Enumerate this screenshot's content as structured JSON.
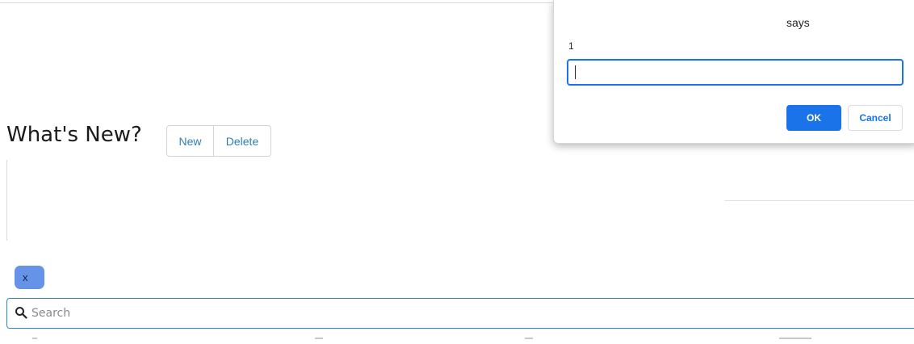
{
  "page": {
    "title": "What's New?",
    "new_label": "New",
    "delete_label": "Delete",
    "chip_label": "x"
  },
  "search": {
    "placeholder": "Search",
    "value": ""
  },
  "dialog": {
    "title": "says",
    "message": "1",
    "input_value": "",
    "ok_label": "OK",
    "cancel_label": "Cancel"
  },
  "colors": {
    "accent": "#1a73e8",
    "chip": "#6693e8",
    "link": "#2f7fb5",
    "search_border": "#2f86b8"
  },
  "icons": {
    "search": "magnifier"
  }
}
